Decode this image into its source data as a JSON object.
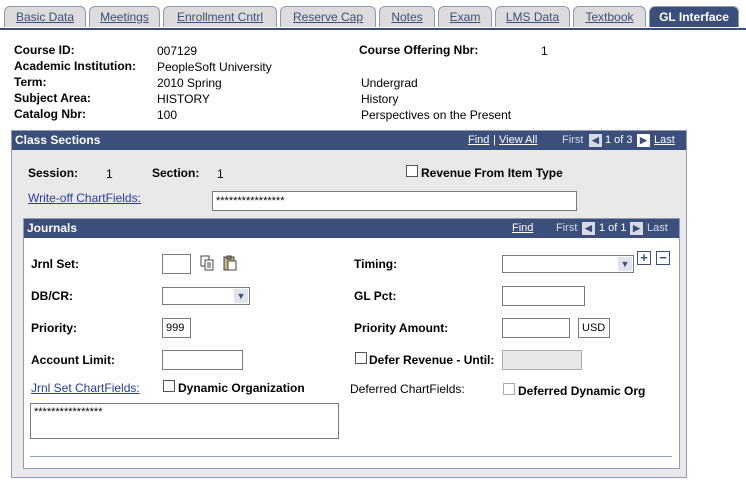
{
  "tabs": [
    {
      "label": "Basic Data"
    },
    {
      "label": "Meetings"
    },
    {
      "label": "Enrollment Cntrl"
    },
    {
      "label": "Reserve Cap"
    },
    {
      "label": "Notes"
    },
    {
      "label": "Exam"
    },
    {
      "label": "LMS Data"
    },
    {
      "label": "Textbook"
    },
    {
      "label": "GL Interface",
      "active": true
    }
  ],
  "header": {
    "course_id_label": "Course ID:",
    "course_id": "007129",
    "institution_label": "Academic Institution:",
    "institution": "PeopleSoft University",
    "term_label": "Term:",
    "term": "2010 Spring",
    "career": "Undergrad",
    "subject_label": "Subject Area:",
    "subject": "HISTORY",
    "subject_desc": "History",
    "catalog_label": "Catalog Nbr:",
    "catalog": "100",
    "catalog_desc": "Perspectives on the Present",
    "offering_label": "Course Offering Nbr:",
    "offering": "1"
  },
  "class_sections": {
    "title": "Class Sections",
    "find": "Find",
    "view_all": "View All",
    "first": "First",
    "count": "1 of 3",
    "last": "Last",
    "session_label": "Session:",
    "session": "1",
    "section_label": "Section:",
    "section": "1",
    "revenue_label": "Revenue From Item Type",
    "writeoff_label": "Write-off ChartFields:",
    "writeoff_value": "****************"
  },
  "journals": {
    "title": "Journals",
    "find": "Find",
    "first": "First",
    "count": "1 of 1",
    "last": "Last",
    "jrnl_set_label": "Jrnl Set:",
    "jrnl_set_value": "",
    "timing_label": "Timing:",
    "timing_value": "",
    "dbcr_label": "DB/CR:",
    "dbcr_value": "",
    "glpct_label": "GL Pct:",
    "glpct_value": "",
    "priority_label": "Priority:",
    "priority_value": "999",
    "priority_amount_label": "Priority Amount:",
    "priority_amount_value": "",
    "currency": "USD",
    "account_limit_label": "Account Limit:",
    "account_limit_value": "",
    "defer_label": "Defer Revenue - Until:",
    "jrnl_chartfields_label": "Jrnl Set ChartFields:",
    "dynamic_org_label": "Dynamic Organization",
    "deferred_chartfields_label": "Deferred ChartFields:",
    "deferred_dynamic_label": "Deferred Dynamic Org",
    "chartfields_value": "****************"
  }
}
